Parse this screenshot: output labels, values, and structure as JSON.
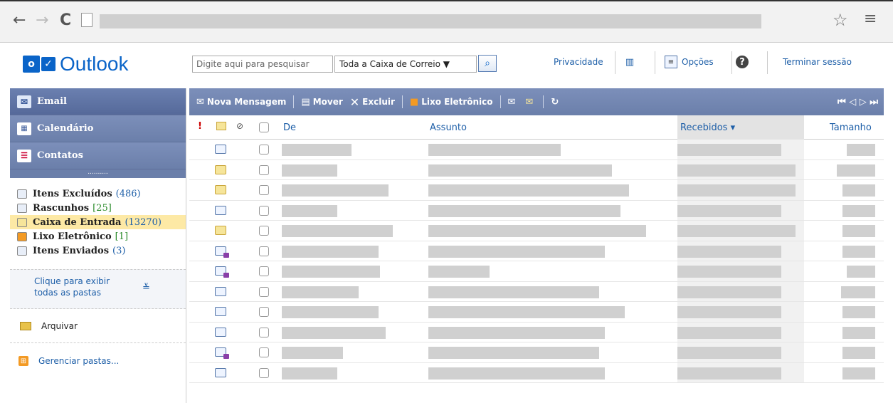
{
  "browser": {
    "back_icon": "←",
    "forward_icon": "→",
    "reload_icon": "C",
    "star_icon": "☆",
    "menu_icon": "≡"
  },
  "header": {
    "logo_text": "Outlook",
    "logo_badge": "o",
    "search_placeholder": "Digite aqui para pesquisar",
    "scope_value": "Toda a Caixa de Correio ▼",
    "privacy": "Privacidade",
    "options": "Opções",
    "signout": "Terminar sessão"
  },
  "sidebar": {
    "nav": [
      {
        "label": "Email"
      },
      {
        "label": "Calendário"
      },
      {
        "label": "Contatos"
      }
    ],
    "dots": "..........",
    "folders": [
      {
        "name": "Itens Excluídos",
        "count": "(486)"
      },
      {
        "name": "Rascunhos",
        "count": "[25]"
      },
      {
        "name": "Caixa de Entrada",
        "count": "(13270)"
      },
      {
        "name": "Lixo Eletrônico",
        "count": "[1]"
      },
      {
        "name": "Itens Enviados",
        "count": "(3)"
      }
    ],
    "show_all": "Clique para exibir todas as pastas",
    "archive": "Arquivar",
    "manage": "Gerenciar pastas..."
  },
  "toolbar": {
    "new_message": "Nova Mensagem",
    "move": "Mover",
    "delete": "Excluir",
    "junk": "Lixo Eletrônico",
    "pager": "⏮ ◁ ▷ ⏭"
  },
  "table": {
    "headers": {
      "from": "De",
      "subject": "Assunto",
      "received": "Recebidos ▾",
      "size": "Tamanho"
    },
    "rows": [
      {
        "icon": "read",
        "from_len": 98,
        "subj_len": 186,
        "recv_len": 146,
        "size_len": 40
      },
      {
        "icon": "unread",
        "from_len": 78,
        "subj_len": 258,
        "recv_len": 166,
        "size_len": 54
      },
      {
        "icon": "unread",
        "from_len": 150,
        "subj_len": 282,
        "recv_len": 166,
        "size_len": 46
      },
      {
        "icon": "read",
        "from_len": 78,
        "subj_len": 270,
        "recv_len": 146,
        "size_len": 46
      },
      {
        "icon": "unread",
        "from_len": 156,
        "subj_len": 306,
        "recv_len": 166,
        "size_len": 46
      },
      {
        "icon": "reply",
        "from_len": 136,
        "subj_len": 248,
        "recv_len": 146,
        "size_len": 46
      },
      {
        "icon": "reply",
        "from_len": 138,
        "subj_len": 86,
        "recv_len": 146,
        "size_len": 40
      },
      {
        "icon": "read",
        "from_len": 108,
        "subj_len": 240,
        "recv_len": 146,
        "size_len": 48
      },
      {
        "icon": "read",
        "from_len": 136,
        "subj_len": 276,
        "recv_len": 146,
        "size_len": 46
      },
      {
        "icon": "read",
        "from_len": 146,
        "subj_len": 248,
        "recv_len": 146,
        "size_len": 46
      },
      {
        "icon": "reply",
        "from_len": 86,
        "subj_len": 240,
        "recv_len": 146,
        "size_len": 46
      },
      {
        "icon": "read",
        "from_len": 78,
        "subj_len": 248,
        "recv_len": 146,
        "size_len": 46
      }
    ]
  }
}
